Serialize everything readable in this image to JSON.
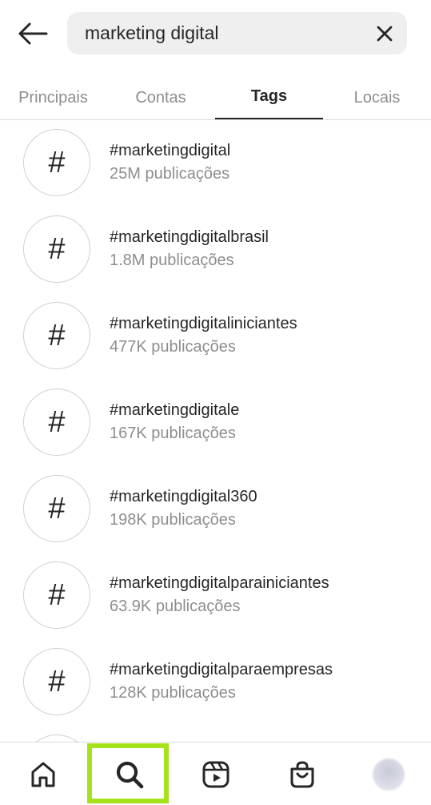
{
  "search": {
    "value": "marketing digital"
  },
  "tabs": [
    {
      "label": "Principais"
    },
    {
      "label": "Contas"
    },
    {
      "label": "Tags"
    },
    {
      "label": "Locais"
    }
  ],
  "results": [
    {
      "icon": "#",
      "tag": "#marketingdigital",
      "count": "25M publicações"
    },
    {
      "icon": "#",
      "tag": "#marketingdigitalbrasil",
      "count": "1.8M publicações"
    },
    {
      "icon": "#",
      "tag": "#marketingdigitaliniciantes",
      "count": "477K publicações"
    },
    {
      "icon": "#",
      "tag": "#marketingdigitale",
      "count": "167K publicações"
    },
    {
      "icon": "#",
      "tag": "#marketingdigital360",
      "count": "198K publicações"
    },
    {
      "icon": "#",
      "tag": "#marketingdigitalparainiciantes",
      "count": "63.9K publicações"
    },
    {
      "icon": "#",
      "tag": "#marketingdigitalparaempresas",
      "count": "128K publicações"
    }
  ],
  "bottom_nav": {
    "items": [
      "home-icon",
      "search-icon",
      "reels-icon",
      "shop-icon",
      "profile-avatar"
    ],
    "active": "search-icon",
    "highlight_color": "#a6e21a"
  },
  "colors": {
    "primary_text": "#262626",
    "secondary_text": "#8e8e8e",
    "search_bg": "#efefef",
    "divider": "#dbdbdb"
  }
}
